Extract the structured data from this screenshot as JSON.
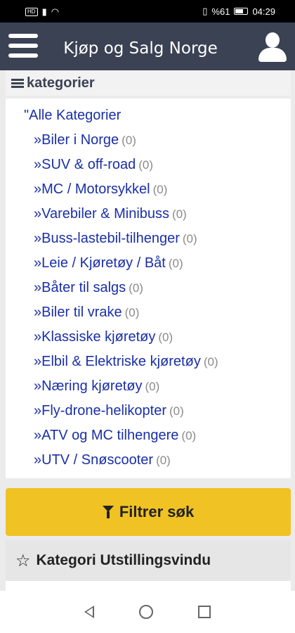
{
  "status_bar": {
    "left_badge": "HD",
    "right_text": "%61",
    "time": "04:29"
  },
  "header": {
    "title": "Kjøp og Salg Norge"
  },
  "categories": {
    "heading": "kategorier",
    "all_label": "\"Alle Kategorier",
    "items": [
      {
        "label": "»Biler i Norge",
        "count": "(0)"
      },
      {
        "label": "»SUV & off-road",
        "count": "(0)"
      },
      {
        "label": "»MC / Motorsykkel",
        "count": "(0)"
      },
      {
        "label": "»Varebiler & Minibuss",
        "count": "(0)"
      },
      {
        "label": "»Buss-lastebil-tilhenger",
        "count": "(0)"
      },
      {
        "label": "»Leie / Kjøretøy / Båt",
        "count": "(0)"
      },
      {
        "label": "»Båter til salgs",
        "count": "(0)"
      },
      {
        "label": "»Biler til vrake",
        "count": "(0)"
      },
      {
        "label": "»Klassiske kjøretøy",
        "count": "(0)"
      },
      {
        "label": "»Elbil & Elektriske kjøretøy",
        "count": "(0)"
      },
      {
        "label": "»Næring kjøretøy",
        "count": "(0)"
      },
      {
        "label": "»Fly-drone-helikopter",
        "count": "(0)"
      },
      {
        "label": "»ATV og MC tilhengere",
        "count": "(0)"
      },
      {
        "label": "»UTV / Snøscooter",
        "count": "(0)"
      }
    ]
  },
  "filter_button": {
    "label": "Filtrer søk",
    "color": "#f0c223"
  },
  "showcase": {
    "label": "Kategori Utstillingsvindu"
  },
  "colors": {
    "header_bg": "#3b4254",
    "link": "#1a2fa8"
  }
}
